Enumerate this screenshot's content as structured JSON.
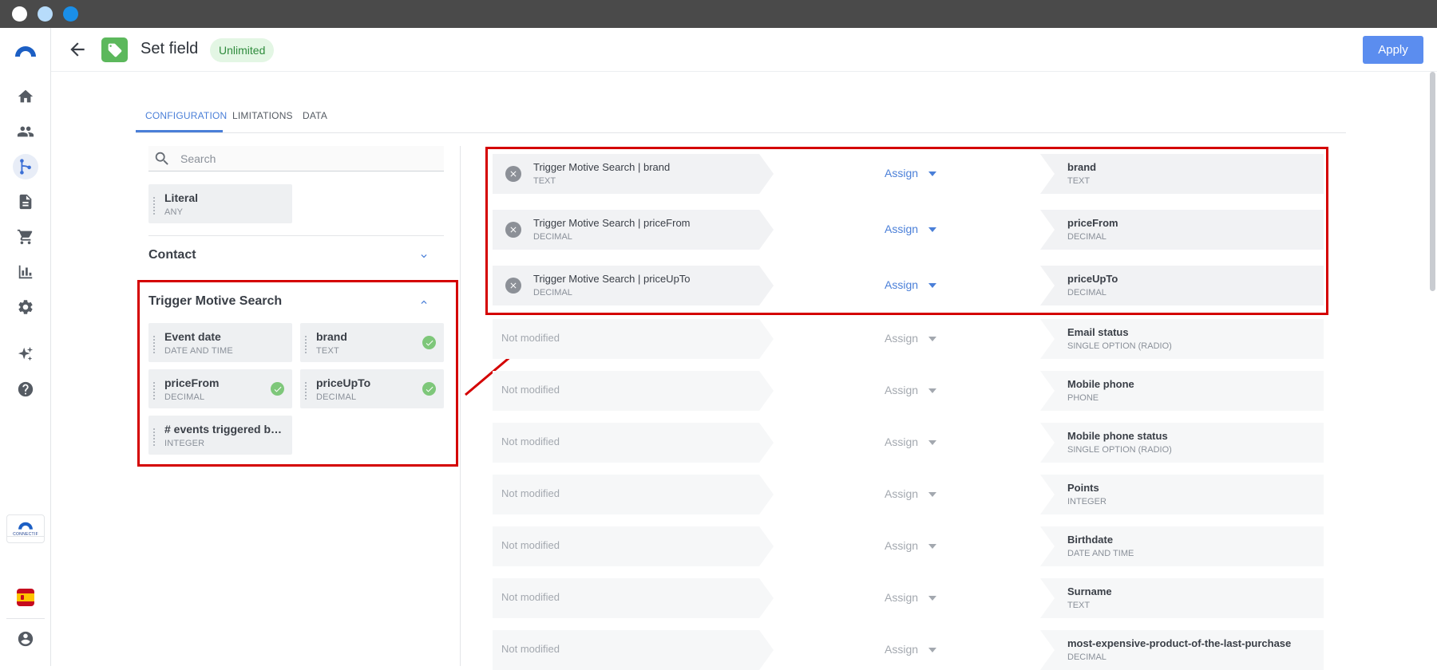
{
  "header": {
    "title": "Set field",
    "badge": "Unlimited",
    "apply_label": "Apply"
  },
  "tabs": [
    {
      "label": "CONFIGURATION",
      "active": true
    },
    {
      "label": "LIMITATIONS",
      "active": false
    },
    {
      "label": "DATA",
      "active": false
    }
  ],
  "search": {
    "placeholder": "Search",
    "value": ""
  },
  "literal": {
    "name": "Literal",
    "type": "ANY"
  },
  "sections": {
    "contact": {
      "title": "Contact",
      "expanded": false
    },
    "trigger": {
      "title": "Trigger Motive Search",
      "expanded": true
    }
  },
  "trigger_fields": [
    {
      "name": "Event date",
      "type": "DATE AND TIME",
      "used": false
    },
    {
      "name": "brand",
      "type": "TEXT",
      "used": true
    },
    {
      "name": "priceFrom",
      "type": "DECIMAL",
      "used": true
    },
    {
      "name": "priceUpTo",
      "type": "DECIMAL",
      "used": true
    },
    {
      "name": "# events triggered by t...",
      "type": "INTEGER",
      "used": false
    }
  ],
  "assign_label": "Assign",
  "not_modified_label": "Not modified",
  "mappings": [
    {
      "source": "Trigger Motive Search | brand",
      "source_type": "TEXT",
      "target": "brand",
      "target_type": "TEXT"
    },
    {
      "source": "Trigger Motive Search | priceFrom",
      "source_type": "DECIMAL",
      "target": "priceFrom",
      "target_type": "DECIMAL"
    },
    {
      "source": "Trigger Motive Search | priceUpTo",
      "source_type": "DECIMAL",
      "target": "priceUpTo",
      "target_type": "DECIMAL"
    },
    {
      "source": "",
      "source_type": "",
      "target": "Email status",
      "target_type": "SINGLE OPTION (RADIO)"
    },
    {
      "source": "",
      "source_type": "",
      "target": "Mobile phone",
      "target_type": "PHONE"
    },
    {
      "source": "",
      "source_type": "",
      "target": "Mobile phone status",
      "target_type": "SINGLE OPTION (RADIO)"
    },
    {
      "source": "",
      "source_type": "",
      "target": "Points",
      "target_type": "INTEGER"
    },
    {
      "source": "",
      "source_type": "",
      "target": "Birthdate",
      "target_type": "DATE AND TIME"
    },
    {
      "source": "",
      "source_type": "",
      "target": "Surname",
      "target_type": "TEXT"
    },
    {
      "source": "",
      "source_type": "",
      "target": "most-expensive-product-of-the-last-purchase",
      "target_type": "DECIMAL"
    }
  ],
  "sidebar": {
    "brand_mini": "CONNECTIF",
    "items": [
      "home-icon",
      "contacts-icon",
      "workflows-icon",
      "content-icon",
      "store-icon",
      "reports-icon",
      "settings-icon",
      "ai-icon",
      "help-icon"
    ]
  },
  "colors": {
    "accent": "#4a7fd8",
    "apply": "#5b8def",
    "highlight": "#d40000",
    "success": "#7ec77a"
  }
}
